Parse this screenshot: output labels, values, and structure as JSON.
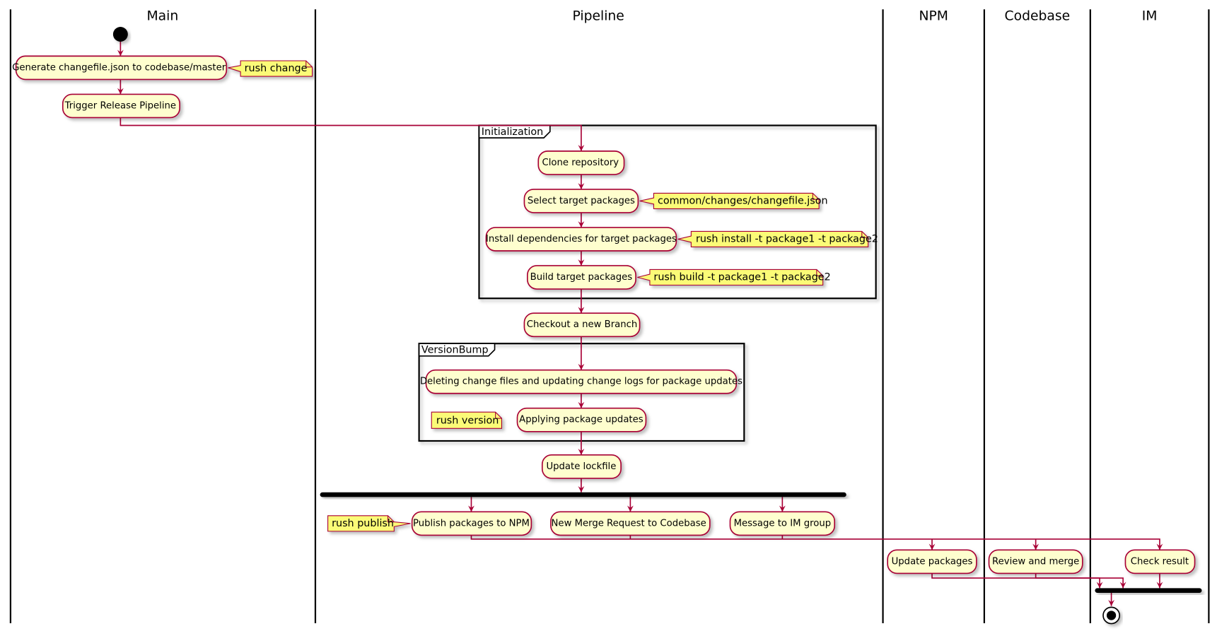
{
  "diagram": {
    "type": "activity-swimlane",
    "colors": {
      "activity_fill": "#FEFECE",
      "activity_border": "#A80036",
      "note_fill": "#FBFB77",
      "edge": "#A80036",
      "lane_line": "#000000"
    },
    "lanes": [
      {
        "id": "main",
        "title": "Main"
      },
      {
        "id": "pipeline",
        "title": "Pipeline"
      },
      {
        "id": "npm",
        "title": "NPM"
      },
      {
        "id": "codebase",
        "title": "Codebase"
      },
      {
        "id": "im",
        "title": "IM"
      }
    ],
    "frames": {
      "initialization": "Initialization",
      "versionbump": "VersionBump"
    },
    "activities": {
      "generate": "Generate changefile.json to codebase/master",
      "trigger": "Trigger Release Pipeline",
      "clone": "Clone repository",
      "select": "Select target packages",
      "install": "Install dependencies for target packages",
      "build": "Build target packages",
      "checkout": "Checkout a new Branch",
      "deleting": "Deleting change files and updating change logs for package updates",
      "applying": "Applying package updates",
      "lockfile": "Update lockfile",
      "publish": "Publish packages to NPM",
      "merge_request": "New Merge Request to Codebase",
      "message": "Message to IM group",
      "update_packages": "Update packages",
      "review": "Review and merge",
      "check": "Check result"
    },
    "notes": {
      "rush_change": "rush change",
      "changefile": "common/changes/changefile.json",
      "rush_install": "rush install -t package1 -t package2",
      "rush_build": "rush build -t package1 -t package2",
      "rush_version": "rush version",
      "rush_publish": "rush publish"
    }
  }
}
